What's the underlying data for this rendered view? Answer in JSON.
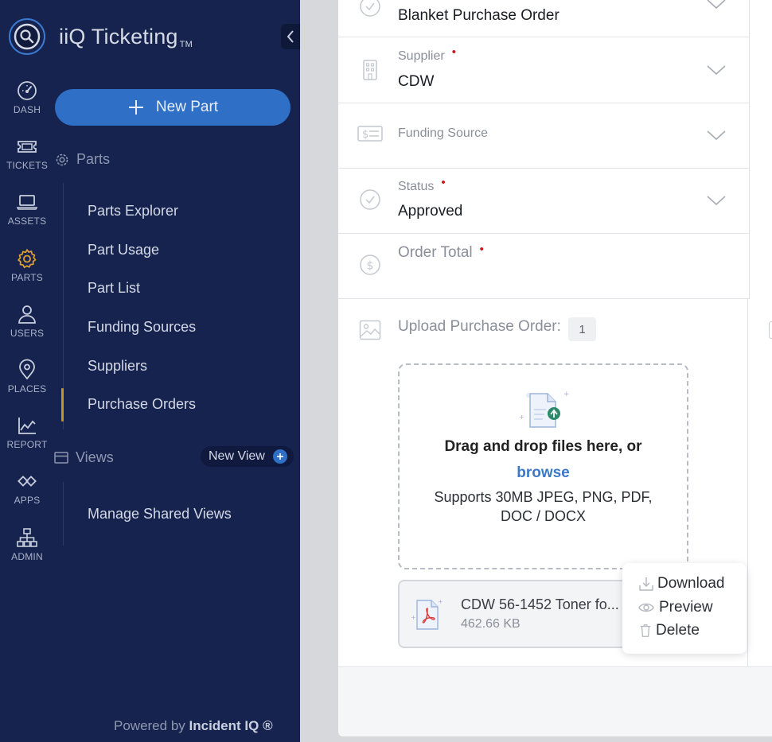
{
  "app": {
    "name": "iiQ Ticketing",
    "trademark": "TM",
    "powered_prefix": "Powered by",
    "powered_brand": "Incident IQ ®"
  },
  "rail": [
    {
      "label": "DASH",
      "icon": "dashboard-icon"
    },
    {
      "label": "TICKETS",
      "icon": "ticket-icon"
    },
    {
      "label": "ASSETS",
      "icon": "laptop-icon"
    },
    {
      "label": "PARTS",
      "icon": "gear-icon"
    },
    {
      "label": "USERS",
      "icon": "user-icon"
    },
    {
      "label": "PLACES",
      "icon": "map-pin-icon"
    },
    {
      "label": "REPORT",
      "icon": "chart-icon"
    },
    {
      "label": "APPS",
      "icon": "apps-icon"
    },
    {
      "label": "ADMIN",
      "icon": "org-chart-icon"
    }
  ],
  "sidebar": {
    "new_button": "New Part",
    "parts_section": "Parts",
    "parts_items": [
      "Parts Explorer",
      "Part Usage",
      "Part List",
      "Funding Sources",
      "Suppliers",
      "Purchase Orders"
    ],
    "active_item": "Purchase Orders",
    "views_section": "Views",
    "new_view": "New View",
    "views_items": [
      "Manage Shared Views"
    ]
  },
  "form": {
    "order_type_value": "Blanket Purchase Order",
    "supplier_label": "Supplier",
    "supplier_value": "CDW",
    "funding_label": "Funding Source",
    "status_label": "Status",
    "status_value": "Approved",
    "total_label": "Order Total",
    "required_marker": "•"
  },
  "upload": {
    "label": "Upload Purchase Order:",
    "count": "1",
    "drop_text": "Drag and drop files here, or",
    "browse": "browse",
    "supports_line1": "Supports 30MB JPEG, PNG, PDF,",
    "supports_line2": "DOC / DOCX",
    "file_name": "CDW 56-1452 Toner fo...",
    "file_size": "462.66 KB"
  },
  "file_menu": {
    "download": "Download",
    "preview": "Preview",
    "delete": "Delete"
  },
  "colors": {
    "sidebar": "#16234f",
    "accent": "#2f6fc6",
    "active": "#c8932a",
    "required": "#c41a1a",
    "link": "#3b79c8"
  }
}
